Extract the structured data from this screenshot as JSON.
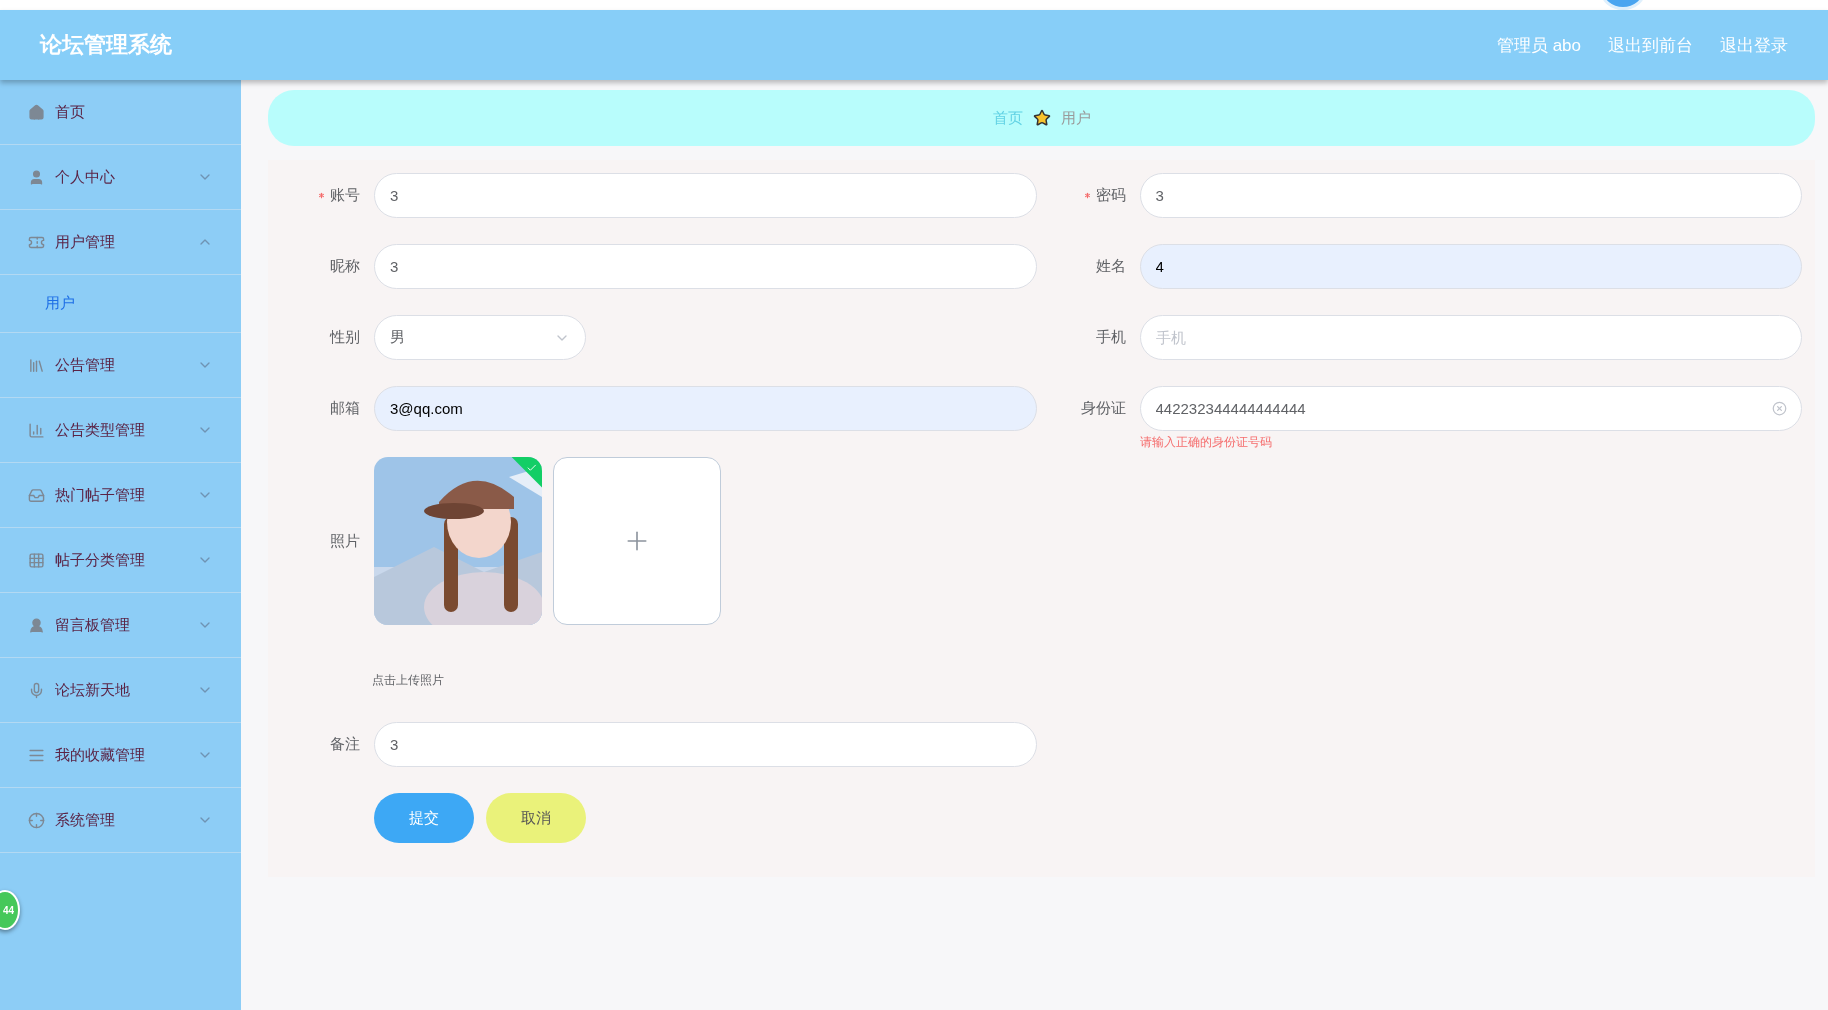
{
  "header": {
    "title": "论坛管理系统",
    "links": [
      "管理员 abo",
      "退出到前台",
      "退出登录"
    ]
  },
  "sidebar": {
    "items": [
      {
        "label": "首页",
        "kind": "link"
      },
      {
        "label": "个人中心",
        "kind": "menu",
        "expanded": false
      },
      {
        "label": "用户管理",
        "kind": "menu",
        "expanded": true,
        "children": [
          {
            "label": "用户",
            "selected": true
          }
        ]
      },
      {
        "label": "公告管理",
        "kind": "menu",
        "expanded": false
      },
      {
        "label": "公告类型管理",
        "kind": "menu",
        "expanded": false
      },
      {
        "label": "热门帖子管理",
        "kind": "menu",
        "expanded": false
      },
      {
        "label": "帖子分类管理",
        "kind": "menu",
        "expanded": false
      },
      {
        "label": "留言板管理",
        "kind": "menu",
        "expanded": false
      },
      {
        "label": "论坛新天地",
        "kind": "menu",
        "expanded": false
      },
      {
        "label": "我的收藏管理",
        "kind": "menu",
        "expanded": false
      },
      {
        "label": "系统管理",
        "kind": "menu",
        "expanded": false
      }
    ]
  },
  "floating_badge": "44",
  "breadcrumb": [
    {
      "label": "首页",
      "selected": false
    },
    {
      "label": "用户",
      "selected": true
    }
  ],
  "form": {
    "rows": [
      [
        {
          "kind": "text",
          "label": "账号",
          "required": true,
          "value": "3"
        },
        {
          "kind": "text",
          "label": "密码",
          "required": true,
          "value": "3"
        }
      ],
      [
        {
          "kind": "text",
          "label": "昵称",
          "required": false,
          "value": "3"
        },
        {
          "kind": "text",
          "label": "姓名",
          "required": false,
          "value": "4",
          "autofilled": true
        }
      ],
      [
        {
          "kind": "select",
          "label": "性别",
          "required": false,
          "value": "男"
        },
        {
          "kind": "text",
          "label": "手机",
          "required": false,
          "placeholder": "手机"
        }
      ],
      [
        {
          "kind": "text",
          "label": "邮箱",
          "required": false,
          "value": "3@qq.com",
          "autofilled": true
        },
        {
          "kind": "text",
          "label": "身份证",
          "required": false,
          "value": "442232344444444444",
          "clearable": true,
          "error": "请输入正确的身份证号码"
        }
      ],
      [
        {
          "kind": "upload",
          "label": "照片",
          "required": false,
          "uploaded": true,
          "hint": "点击上传照片"
        }
      ],
      [
        {
          "kind": "text",
          "label": "备注",
          "required": false,
          "value": "3"
        }
      ]
    ],
    "buttons": [
      {
        "label": "提交",
        "kind": "primary"
      },
      {
        "label": "取消",
        "kind": "cancel"
      }
    ]
  }
}
